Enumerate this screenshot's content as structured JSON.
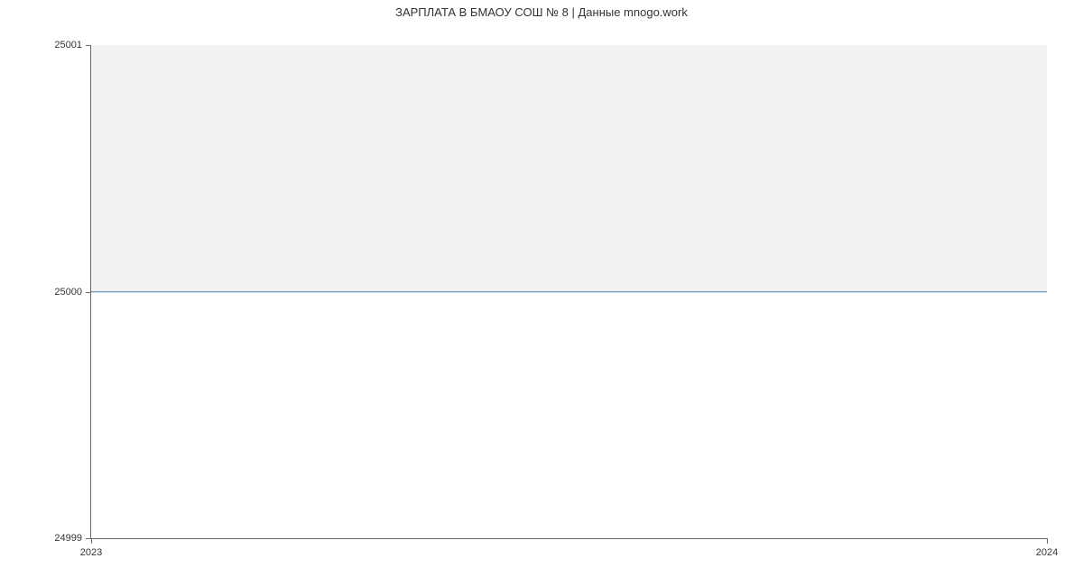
{
  "chart_data": {
    "type": "line",
    "title": "ЗАРПЛАТА В БМАОУ СОШ № 8 | Данные mnogo.work",
    "x": [
      2023,
      2024
    ],
    "values": [
      25000,
      25000
    ],
    "xlim": [
      2023,
      2024
    ],
    "ylim": [
      24999,
      25001
    ],
    "x_ticks": [
      "2023",
      "2024"
    ],
    "y_ticks": [
      "24999",
      "25000",
      "25001"
    ],
    "line_color": "#4878b8",
    "grid": false
  }
}
